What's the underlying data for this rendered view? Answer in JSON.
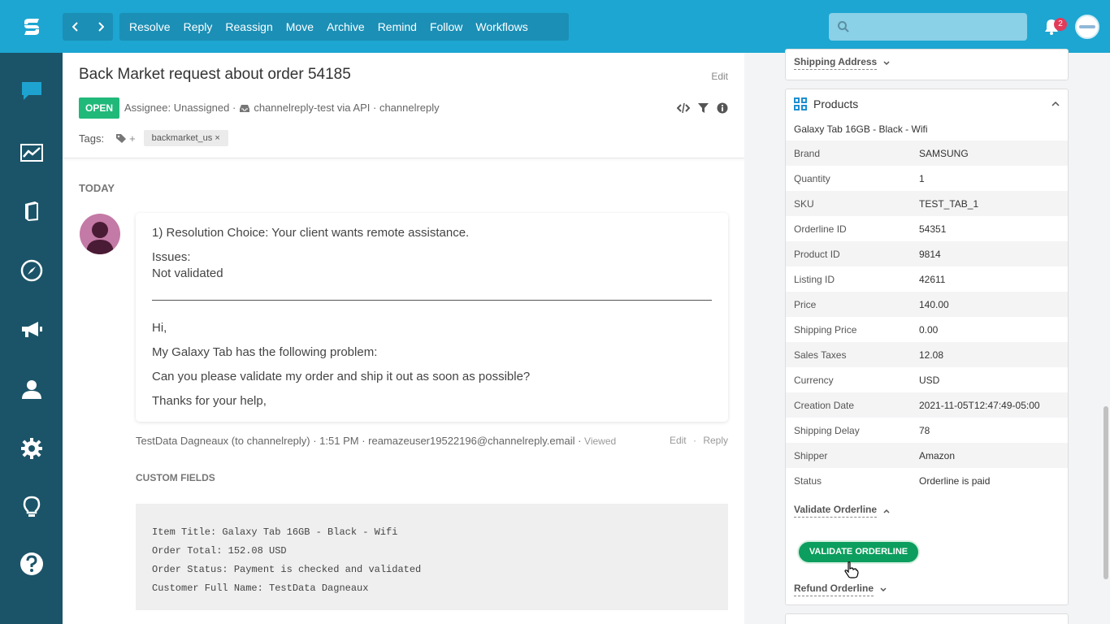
{
  "topbar": {
    "actions": [
      "Resolve",
      "Reply",
      "Reassign",
      "Move",
      "Archive",
      "Remind",
      "Follow",
      "Workflows"
    ],
    "search_placeholder": "",
    "notification_count": "2",
    "prev_icon": "chevron-left-icon",
    "next_icon": "chevron-right-icon"
  },
  "sidebar": {
    "items": [
      "chat-icon",
      "chart-icon",
      "book-icon",
      "compass-icon",
      "megaphone-icon",
      "user-icon",
      "gear-icon",
      "lightbulb-icon",
      "help-icon"
    ]
  },
  "conversation": {
    "title": "Back Market request about order 54185",
    "edit": "Edit",
    "status": "OPEN",
    "assignee": "Assignee: Unassigned ·",
    "channel": "channelreply-test via API · channelreply",
    "tags_label": "Tags:",
    "tag_add": "+",
    "tags": [
      "backmarket_us ×"
    ]
  },
  "thread": {
    "day_label": "TODAY",
    "message": {
      "line1": "1) Resolution Choice: Your client wants remote assistance.",
      "issues_label": "Issues:",
      "issues_value": "Not validated",
      "greeting": "Hi,",
      "body1": "My Galaxy Tab has the following problem:",
      "body2": "Can you please validate my order and ship it out as soon as possible?",
      "closing": "Thanks for your help,"
    },
    "footer": {
      "meta": "TestData Dagneaux (to channelreply) · 1:51 PM · reamazeuser19522196@channelreply.email ·",
      "viewed": "Viewed",
      "edit": "Edit",
      "sep": "·",
      "reply": "Reply"
    },
    "custom_fields_label": "CUSTOM FIELDS",
    "custom_fields": [
      "Item Title: Galaxy Tab 16GB - Black - Wifi",
      "Order Total: 152.08 USD",
      "Order Status: Payment is checked and validated",
      "Customer Full Name: TestData Dagneaux"
    ]
  },
  "right_panel": {
    "shipping_address": "Shipping Address",
    "products_title": "Products",
    "product_name": "Galaxy Tab 16GB - Black - Wifi",
    "rows": [
      {
        "k": "Brand",
        "v": "SAMSUNG"
      },
      {
        "k": "Quantity",
        "v": "1"
      },
      {
        "k": "SKU",
        "v": "TEST_TAB_1"
      },
      {
        "k": "Orderline ID",
        "v": "54351"
      },
      {
        "k": "Product ID",
        "v": "9814"
      },
      {
        "k": "Listing ID",
        "v": "42611"
      },
      {
        "k": "Price",
        "v": "140.00"
      },
      {
        "k": "Shipping Price",
        "v": "0.00"
      },
      {
        "k": "Sales Taxes",
        "v": "12.08"
      },
      {
        "k": "Currency",
        "v": "USD"
      },
      {
        "k": "Creation Date",
        "v": "2021-11-05T12:47:49-05:00"
      },
      {
        "k": "Shipping Delay",
        "v": "78"
      },
      {
        "k": "Shipper",
        "v": "Amazon"
      },
      {
        "k": "Status",
        "v": "Orderline is paid"
      }
    ],
    "validate_link": "Validate Orderline",
    "validate_button": "VALIDATE ORDERLINE",
    "refund_link": "Refund Orderline"
  },
  "colors": {
    "topbar": "#1da6d1",
    "sidebar": "#1b5468",
    "open_badge": "#20b97a",
    "validate_button": "#0c9e5e",
    "notification_badge": "#e23b5a"
  }
}
